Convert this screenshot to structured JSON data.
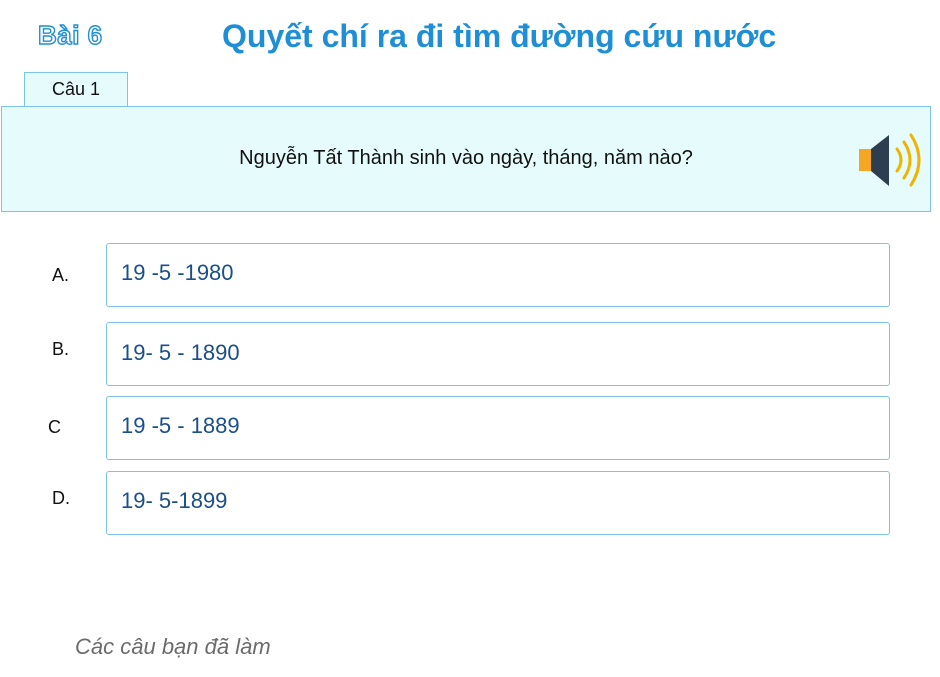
{
  "header": {
    "lesson": "Bài 6",
    "title": "Quyết chí ra đi tìm đường cứu nước"
  },
  "question": {
    "tab_label": "Câu 1",
    "text": "Nguyễn Tất Thành sinh vào ngày, tháng, năm nào?",
    "audio_icon": "speaker-icon",
    "colors": {
      "speaker_body": "#f5a623",
      "speaker_cone": "#2d3e50",
      "sound_waves": "#f0b400"
    }
  },
  "answers": [
    {
      "letter": "A.",
      "text": "19 -5 -1980"
    },
    {
      "letter": "B.",
      "text": "19- 5 - 1890"
    },
    {
      "letter": "C",
      "text": "19 -5 - 1889"
    },
    {
      "letter": "D.",
      "text": "19- 5-1899"
    }
  ],
  "footer": {
    "done_label": "Các câu bạn đã làm"
  },
  "colors": {
    "accent": "#1e8fd6",
    "question_bg": "#e6fbfb",
    "border": "#7ec3ea",
    "answer_text": "#1a4f8a"
  }
}
